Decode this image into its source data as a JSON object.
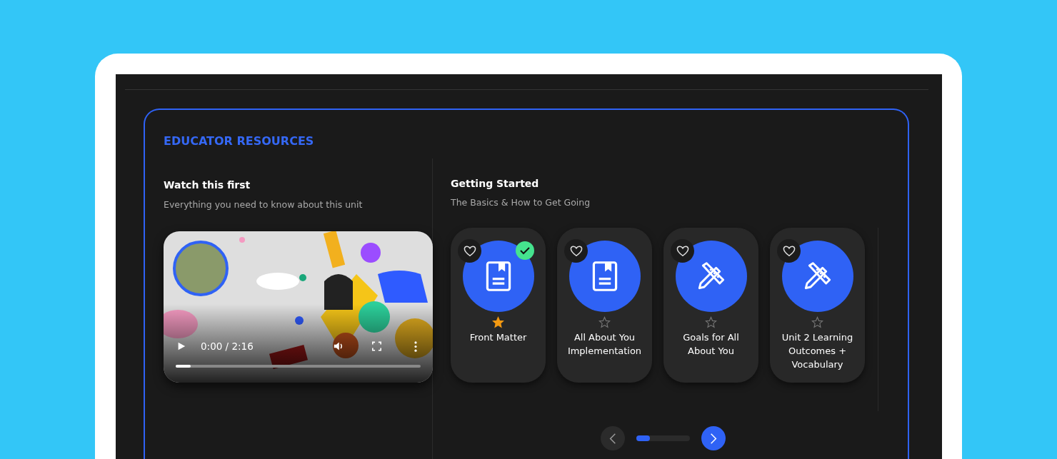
{
  "section": {
    "title": "EDUCATOR RESOURCES"
  },
  "video_panel": {
    "title": "Watch this first",
    "subtitle": "Everything you need to know about this unit",
    "player": {
      "time": "0:00 / 2:16",
      "level": 0.06
    }
  },
  "resources": {
    "title": "Getting Started",
    "subtitle": "The Basics & How to Get Going",
    "cards": [
      {
        "label": "Front Matter",
        "kind": "book",
        "favorite": false,
        "starred": true,
        "completed": true
      },
      {
        "label": "All About You Implementation",
        "kind": "book",
        "favorite": false,
        "starred": false,
        "completed": false
      },
      {
        "label": "Goals for All About You",
        "kind": "tools",
        "favorite": false,
        "starred": false,
        "completed": false
      },
      {
        "label": "Unit 2 Learning Outcomes + Vocabulary",
        "kind": "tools",
        "favorite": false,
        "starred": false,
        "completed": false
      }
    ],
    "pager": {
      "prev_disabled": true,
      "next_disabled": false,
      "level": 0.25
    }
  }
}
